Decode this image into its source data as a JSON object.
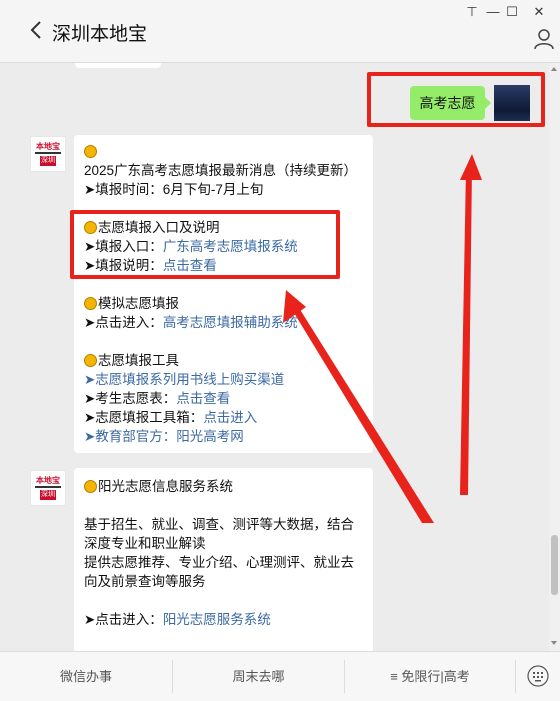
{
  "window": {
    "title": "深圳本地宝",
    "controls": {
      "pin": "⊤",
      "minimize": "—",
      "maximize": "☐",
      "close": "✕"
    }
  },
  "my_message": {
    "text": "高考志愿"
  },
  "bot": {
    "logo_text": "本地宝",
    "logo_sub": "深圳"
  },
  "card1": {
    "title": "2025广东高考志愿填报最新消息（持续更新）",
    "time_label": "➤填报时间：6月下旬-7月上旬",
    "entry_title": "志愿填报入口及说明",
    "entry_label": "➤填报入口：",
    "entry_link": "广东高考志愿填报系统",
    "guide_label": "➤填报说明：",
    "guide_link": "点击查看",
    "mock_title": "模拟志愿填报",
    "mock_label": "➤点击进入：",
    "mock_link": "高考志愿填报辅助系统",
    "tools_title": "志愿填报工具",
    "tools_item1": "➤志愿填报系列用书线上购买渠道",
    "tools_item2_label": "➤考生志愿表：",
    "tools_item2_link": "点击查看",
    "tools_item3_label": "➤志愿填报工具箱：",
    "tools_item3_link": "点击进入",
    "tools_item4": "➤教育部官方：阳光高考网"
  },
  "card2": {
    "title": "阳光志愿信息服务系统",
    "desc1": "基于招生、就业、调查、测评等大数据，结合深度专业和职业解读",
    "desc2": "提供志愿推荐、专业介绍、心理测评、就业去向及前景查询等服务",
    "enter_label": "➤点击进入：",
    "enter_link": "阳光志愿服务系统"
  },
  "bottom_menu": {
    "item1": "微信办事",
    "item2": "周末去哪",
    "item3": "≡ 免限行|高考"
  },
  "colors": {
    "accent_annotation": "#e8231b",
    "link": "#3b6aa3",
    "my_bubble": "#95ec69"
  }
}
